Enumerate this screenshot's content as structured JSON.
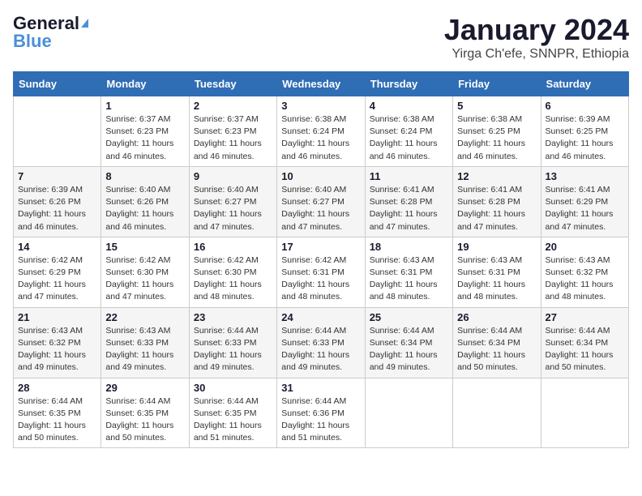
{
  "header": {
    "logo_general": "General",
    "logo_blue": "Blue",
    "month_title": "January 2024",
    "location": "Yirga Ch'efe, SNNPR, Ethiopia"
  },
  "days_of_week": [
    "Sunday",
    "Monday",
    "Tuesday",
    "Wednesday",
    "Thursday",
    "Friday",
    "Saturday"
  ],
  "weeks": [
    [
      {
        "num": "",
        "info": ""
      },
      {
        "num": "1",
        "info": "Sunrise: 6:37 AM\nSunset: 6:23 PM\nDaylight: 11 hours\nand 46 minutes."
      },
      {
        "num": "2",
        "info": "Sunrise: 6:37 AM\nSunset: 6:23 PM\nDaylight: 11 hours\nand 46 minutes."
      },
      {
        "num": "3",
        "info": "Sunrise: 6:38 AM\nSunset: 6:24 PM\nDaylight: 11 hours\nand 46 minutes."
      },
      {
        "num": "4",
        "info": "Sunrise: 6:38 AM\nSunset: 6:24 PM\nDaylight: 11 hours\nand 46 minutes."
      },
      {
        "num": "5",
        "info": "Sunrise: 6:38 AM\nSunset: 6:25 PM\nDaylight: 11 hours\nand 46 minutes."
      },
      {
        "num": "6",
        "info": "Sunrise: 6:39 AM\nSunset: 6:25 PM\nDaylight: 11 hours\nand 46 minutes."
      }
    ],
    [
      {
        "num": "7",
        "info": "Sunrise: 6:39 AM\nSunset: 6:26 PM\nDaylight: 11 hours\nand 46 minutes."
      },
      {
        "num": "8",
        "info": "Sunrise: 6:40 AM\nSunset: 6:26 PM\nDaylight: 11 hours\nand 46 minutes."
      },
      {
        "num": "9",
        "info": "Sunrise: 6:40 AM\nSunset: 6:27 PM\nDaylight: 11 hours\nand 47 minutes."
      },
      {
        "num": "10",
        "info": "Sunrise: 6:40 AM\nSunset: 6:27 PM\nDaylight: 11 hours\nand 47 minutes."
      },
      {
        "num": "11",
        "info": "Sunrise: 6:41 AM\nSunset: 6:28 PM\nDaylight: 11 hours\nand 47 minutes."
      },
      {
        "num": "12",
        "info": "Sunrise: 6:41 AM\nSunset: 6:28 PM\nDaylight: 11 hours\nand 47 minutes."
      },
      {
        "num": "13",
        "info": "Sunrise: 6:41 AM\nSunset: 6:29 PM\nDaylight: 11 hours\nand 47 minutes."
      }
    ],
    [
      {
        "num": "14",
        "info": "Sunrise: 6:42 AM\nSunset: 6:29 PM\nDaylight: 11 hours\nand 47 minutes."
      },
      {
        "num": "15",
        "info": "Sunrise: 6:42 AM\nSunset: 6:30 PM\nDaylight: 11 hours\nand 47 minutes."
      },
      {
        "num": "16",
        "info": "Sunrise: 6:42 AM\nSunset: 6:30 PM\nDaylight: 11 hours\nand 48 minutes."
      },
      {
        "num": "17",
        "info": "Sunrise: 6:42 AM\nSunset: 6:31 PM\nDaylight: 11 hours\nand 48 minutes."
      },
      {
        "num": "18",
        "info": "Sunrise: 6:43 AM\nSunset: 6:31 PM\nDaylight: 11 hours\nand 48 minutes."
      },
      {
        "num": "19",
        "info": "Sunrise: 6:43 AM\nSunset: 6:31 PM\nDaylight: 11 hours\nand 48 minutes."
      },
      {
        "num": "20",
        "info": "Sunrise: 6:43 AM\nSunset: 6:32 PM\nDaylight: 11 hours\nand 48 minutes."
      }
    ],
    [
      {
        "num": "21",
        "info": "Sunrise: 6:43 AM\nSunset: 6:32 PM\nDaylight: 11 hours\nand 49 minutes."
      },
      {
        "num": "22",
        "info": "Sunrise: 6:43 AM\nSunset: 6:33 PM\nDaylight: 11 hours\nand 49 minutes."
      },
      {
        "num": "23",
        "info": "Sunrise: 6:44 AM\nSunset: 6:33 PM\nDaylight: 11 hours\nand 49 minutes."
      },
      {
        "num": "24",
        "info": "Sunrise: 6:44 AM\nSunset: 6:33 PM\nDaylight: 11 hours\nand 49 minutes."
      },
      {
        "num": "25",
        "info": "Sunrise: 6:44 AM\nSunset: 6:34 PM\nDaylight: 11 hours\nand 49 minutes."
      },
      {
        "num": "26",
        "info": "Sunrise: 6:44 AM\nSunset: 6:34 PM\nDaylight: 11 hours\nand 50 minutes."
      },
      {
        "num": "27",
        "info": "Sunrise: 6:44 AM\nSunset: 6:34 PM\nDaylight: 11 hours\nand 50 minutes."
      }
    ],
    [
      {
        "num": "28",
        "info": "Sunrise: 6:44 AM\nSunset: 6:35 PM\nDaylight: 11 hours\nand 50 minutes."
      },
      {
        "num": "29",
        "info": "Sunrise: 6:44 AM\nSunset: 6:35 PM\nDaylight: 11 hours\nand 50 minutes."
      },
      {
        "num": "30",
        "info": "Sunrise: 6:44 AM\nSunset: 6:35 PM\nDaylight: 11 hours\nand 51 minutes."
      },
      {
        "num": "31",
        "info": "Sunrise: 6:44 AM\nSunset: 6:36 PM\nDaylight: 11 hours\nand 51 minutes."
      },
      {
        "num": "",
        "info": ""
      },
      {
        "num": "",
        "info": ""
      },
      {
        "num": "",
        "info": ""
      }
    ]
  ]
}
